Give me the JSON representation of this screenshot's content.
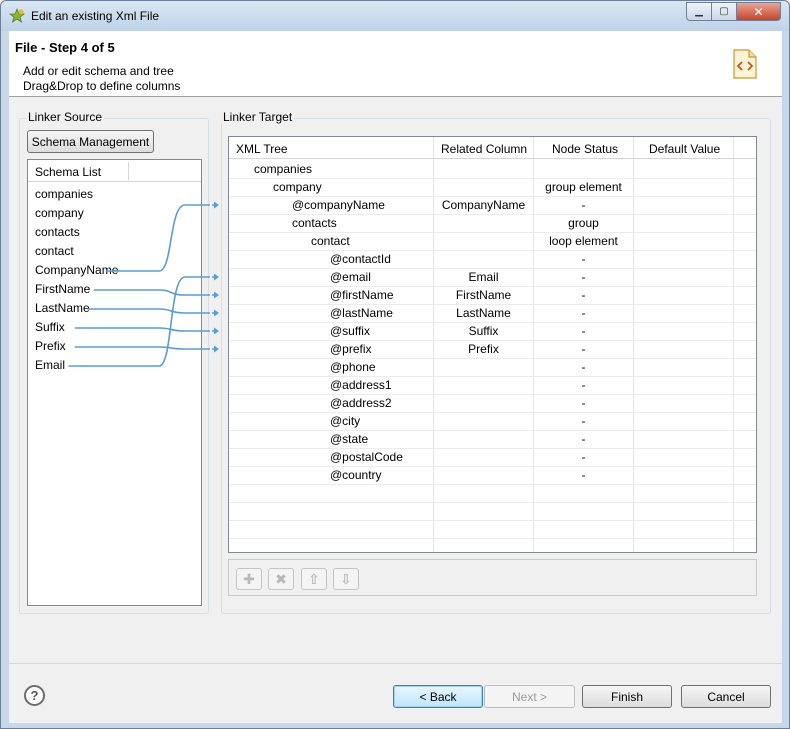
{
  "window": {
    "title": "Edit an existing Xml File"
  },
  "header": {
    "step_title": "File - Step 4 of 5",
    "desc_line1": "Add or edit schema and tree",
    "desc_line2": "Drag&Drop to define columns",
    "icon": "xml-file-icon"
  },
  "linker_source": {
    "title": "Linker Source",
    "schema_button": "Schema Management",
    "list_header": "Schema List",
    "items": [
      "companies",
      "company",
      "contacts",
      "contact",
      "CompanyName",
      "FirstName",
      "LastName",
      "Suffix",
      "Prefix",
      "Email"
    ]
  },
  "linker_target": {
    "title": "Linker Target",
    "columns": [
      "XML Tree",
      "Related Column",
      "Node Status",
      "Default Value"
    ],
    "rows": [
      {
        "name": "companies",
        "indent": 0,
        "related": "",
        "status": ""
      },
      {
        "name": "company",
        "indent": 1,
        "related": "",
        "status": "group element"
      },
      {
        "name": "@companyName",
        "indent": 2,
        "related": "CompanyName",
        "status": "-"
      },
      {
        "name": "contacts",
        "indent": 2,
        "related": "",
        "status": "group"
      },
      {
        "name": "contact",
        "indent": 3,
        "related": "",
        "status": "loop element"
      },
      {
        "name": "@contactId",
        "indent": 4,
        "related": "",
        "status": "-"
      },
      {
        "name": "@email",
        "indent": 4,
        "related": "Email",
        "status": "-"
      },
      {
        "name": "@firstName",
        "indent": 4,
        "related": "FirstName",
        "status": "-"
      },
      {
        "name": "@lastName",
        "indent": 4,
        "related": "LastName",
        "status": "-"
      },
      {
        "name": "@suffix",
        "indent": 4,
        "related": "Suffix",
        "status": "-"
      },
      {
        "name": "@prefix",
        "indent": 4,
        "related": "Prefix",
        "status": "-"
      },
      {
        "name": "@phone",
        "indent": 4,
        "related": "",
        "status": "-"
      },
      {
        "name": "@address1",
        "indent": 4,
        "related": "",
        "status": "-"
      },
      {
        "name": "@address2",
        "indent": 4,
        "related": "",
        "status": "-"
      },
      {
        "name": "@city",
        "indent": 4,
        "related": "",
        "status": "-"
      },
      {
        "name": "@state",
        "indent": 4,
        "related": "",
        "status": "-"
      },
      {
        "name": "@postalCode",
        "indent": 4,
        "related": "",
        "status": "-"
      },
      {
        "name": "@country",
        "indent": 4,
        "related": "",
        "status": "-"
      }
    ],
    "toolbar": [
      "add-icon",
      "delete-icon",
      "move-up-icon",
      "move-down-icon"
    ]
  },
  "links": [
    {
      "from": "CompanyName",
      "to": "@companyName"
    },
    {
      "from": "FirstName",
      "to": "@firstName"
    },
    {
      "from": "LastName",
      "to": "@lastName"
    },
    {
      "from": "Suffix",
      "to": "@suffix"
    },
    {
      "from": "Prefix",
      "to": "@prefix"
    },
    {
      "from": "Email",
      "to": "@email"
    }
  ],
  "footer": {
    "back": "< Back",
    "next": "Next >",
    "finish": "Finish",
    "cancel": "Cancel",
    "help": "?"
  },
  "colors": {
    "link": "#5b9bd5",
    "accent": "#3c7fb1"
  }
}
